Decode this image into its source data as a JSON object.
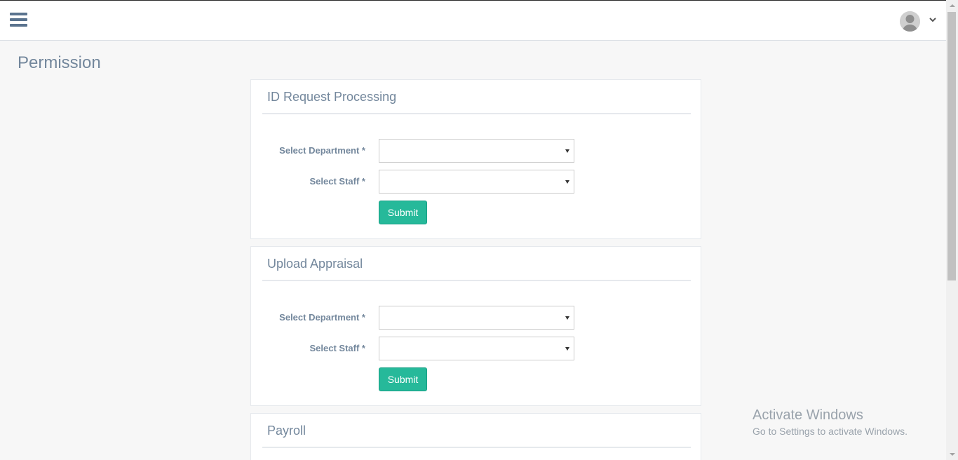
{
  "header": {
    "menu_icon": "hamburger-menu-icon",
    "avatar_icon": "user-avatar-icon",
    "dropdown_icon": "chevron-down-icon"
  },
  "page": {
    "title": "Permission"
  },
  "panels": [
    {
      "title": "ID Request Processing",
      "department_label": "Select Department *",
      "department_value": "",
      "staff_label": "Select Staff *",
      "staff_value": "",
      "submit_label": "Submit"
    },
    {
      "title": "Upload Appraisal",
      "department_label": "Select Department *",
      "department_value": "",
      "staff_label": "Select Staff *",
      "staff_value": "",
      "submit_label": "Submit"
    },
    {
      "title": "Payroll"
    }
  ],
  "watermark": {
    "line1": "Activate Windows",
    "line2": "Go to Settings to activate Windows."
  },
  "colors": {
    "accent": "#26b99a",
    "text": "#73879c",
    "header_bg": "#ffffff",
    "page_bg": "#f7f7f7"
  }
}
